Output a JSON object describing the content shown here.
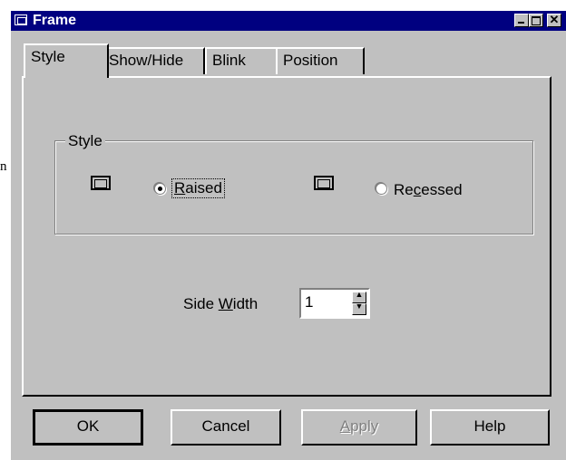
{
  "stray_glyph": "n",
  "window": {
    "title": "Frame",
    "controls": {
      "minimize": "minimize",
      "maximize": "maximize",
      "close": "✕"
    }
  },
  "tabs": [
    {
      "label": "Style",
      "active": true
    },
    {
      "label": "Show/Hide",
      "active": false
    },
    {
      "label": "Blink",
      "active": false
    },
    {
      "label": "Position",
      "active": false
    }
  ],
  "style_group": {
    "label": "Style",
    "options": [
      {
        "label_pre": "",
        "label_key": "R",
        "label_post": "aised",
        "checked": true
      },
      {
        "label_pre": "Re",
        "label_key": "c",
        "label_post": "essed",
        "checked": false
      }
    ]
  },
  "side_width": {
    "label_pre": "Side ",
    "label_key": "W",
    "label_post": "idth",
    "value": "1"
  },
  "buttons": {
    "ok": "OK",
    "cancel": "Cancel",
    "apply_pre": "",
    "apply_key": "A",
    "apply_post": "pply",
    "help": "Help"
  },
  "colors": {
    "titlebar": "#000080",
    "face": "#c0c0c0",
    "disabled_text": "#808080"
  }
}
